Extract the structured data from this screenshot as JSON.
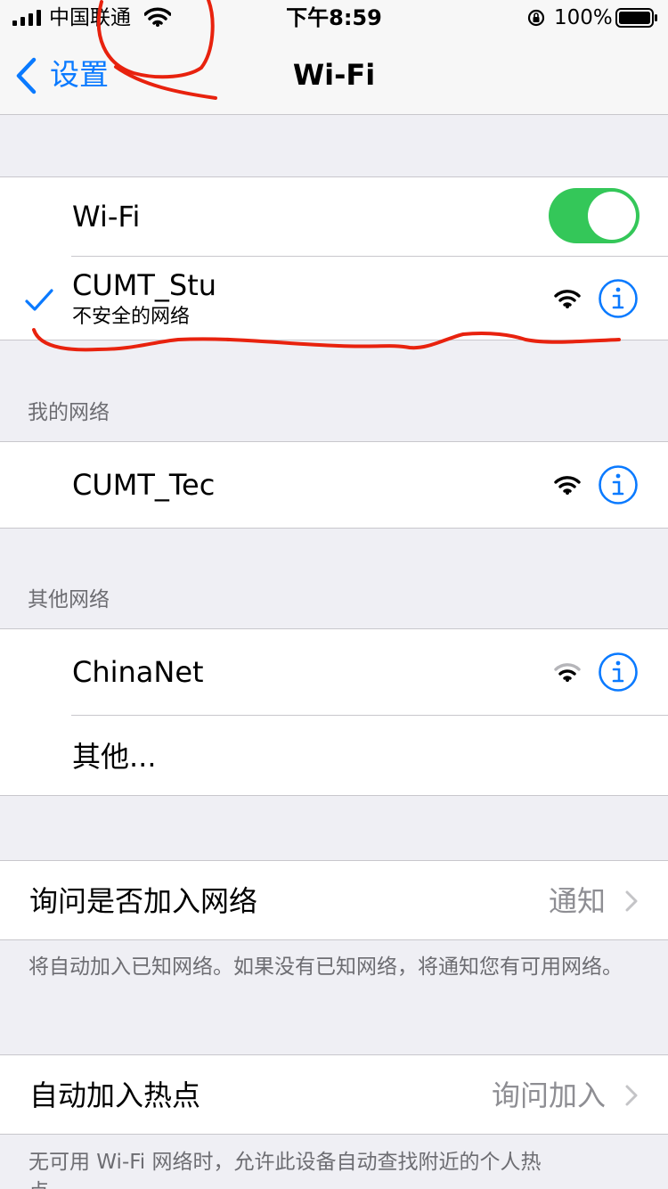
{
  "status_bar": {
    "carrier": "中国联通",
    "time": "下午8:59",
    "battery_percent": "100%",
    "icons": [
      "cellular-signal-icon",
      "wifi-icon",
      "orientation-lock-icon",
      "battery-icon"
    ]
  },
  "nav": {
    "back_label": "设置",
    "title": "Wi-Fi"
  },
  "wifi_toggle": {
    "label": "Wi-Fi",
    "on": true
  },
  "connected_network": {
    "name": "CUMT_Stu",
    "subtitle": "不安全的网络"
  },
  "my_networks": {
    "header": "我的网络",
    "items": [
      {
        "name": "CUMT_Tec"
      }
    ]
  },
  "other_networks": {
    "header": "其他网络",
    "items": [
      {
        "name": "ChinaNet"
      }
    ],
    "other_label": "其他..."
  },
  "ask_to_join": {
    "label": "询问是否加入网络",
    "value": "通知",
    "footer": "将自动加入已知网络。如果没有已知网络，将通知您有可用网络。"
  },
  "auto_join_hotspot": {
    "label": "自动加入热点",
    "value": "询问加入",
    "footer": "无可用 Wi-Fi 网络时，允许此设备自动查找附近的个人热点。"
  },
  "colors": {
    "accent": "#0a7aff",
    "toggle_on": "#34c759",
    "annotation": "#e8220e",
    "background": "#efeff4"
  }
}
